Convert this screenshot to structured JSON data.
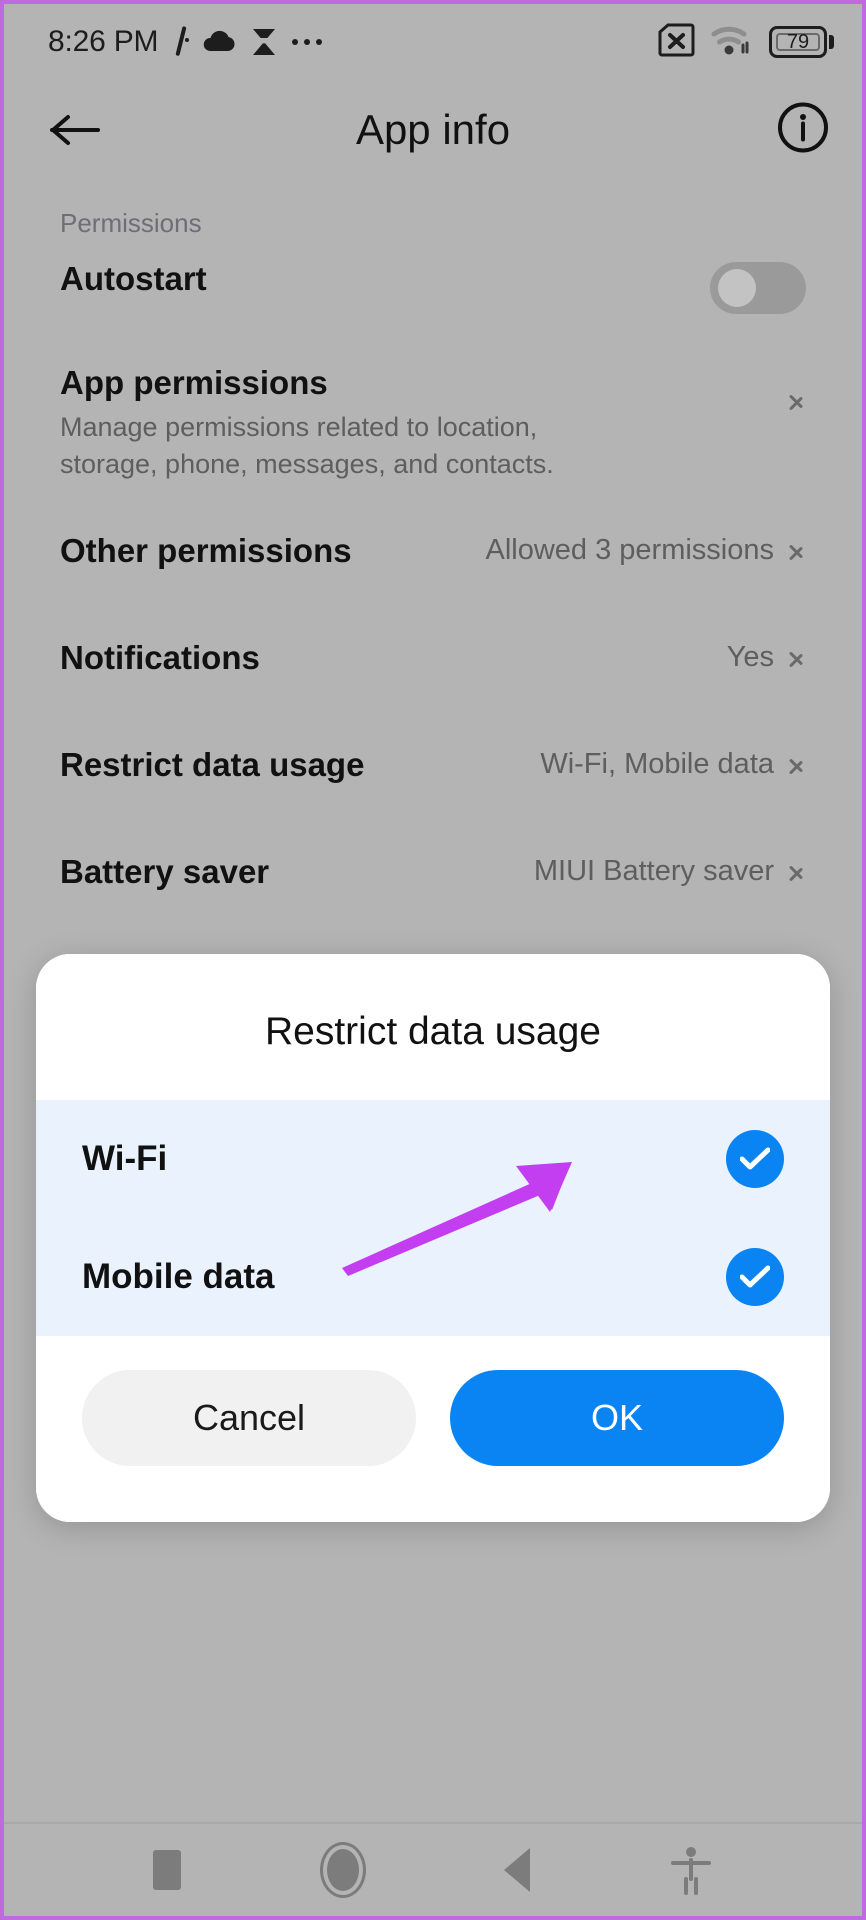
{
  "status_bar": {
    "clock": "8:26 PM",
    "left_icons": [
      "signal-slash-icon",
      "cloud-icon",
      "sync-icon",
      "overflow-dots-icon"
    ],
    "right_icons": [
      "sim-card-error-icon",
      "wifi-icon",
      "battery-icon"
    ],
    "battery_level": "79"
  },
  "app_bar": {
    "title": "App info",
    "back_icon": "back-arrow-icon",
    "info_icon": "info-circle-icon"
  },
  "settings": {
    "section_label": "Permissions",
    "rows": [
      {
        "title": "Autostart",
        "desc": "",
        "value": "",
        "control": "toggle",
        "toggle_on": false
      },
      {
        "title": "App permissions",
        "desc": "Manage permissions related to location, storage, phone, messages, and contacts.",
        "value": "",
        "control": "chevron"
      },
      {
        "title": "Other permissions",
        "desc": "",
        "value": "Allowed 3 permissions",
        "control": "chevron"
      },
      {
        "title": "Notifications",
        "desc": "",
        "value": "Yes",
        "control": "chevron"
      },
      {
        "title": "Restrict data usage",
        "desc": "",
        "value": "Wi-Fi, Mobile data",
        "control": "chevron"
      },
      {
        "title": "Battery saver",
        "desc": "",
        "value": "MIUI Battery saver",
        "control": "chevron"
      }
    ]
  },
  "dialog": {
    "title": "Restrict data usage",
    "options": [
      {
        "label": "Wi-Fi",
        "checked": true
      },
      {
        "label": "Mobile data",
        "checked": true
      }
    ],
    "cancel_label": "Cancel",
    "ok_label": "OK"
  },
  "nav_bar": {
    "items": [
      "recents-square-icon",
      "home-circle-icon",
      "back-triangle-icon",
      "accessibility-icon"
    ]
  },
  "colors": {
    "accent_blue": "#0b84f3",
    "option_row_bg": "#e9f2fd",
    "dialog_bg": "#ffffff",
    "screen_bg": "#b4b4b4",
    "annotation_arrow": "#c33ef0",
    "frame_border": "#c06ae0"
  }
}
